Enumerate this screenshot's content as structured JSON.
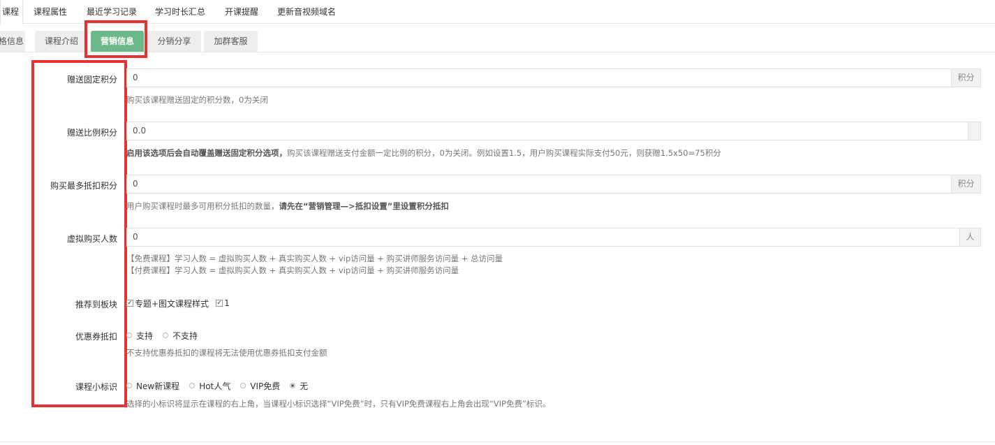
{
  "top_tabs": [
    "课程",
    "课程属性",
    "最近学习记录",
    "学习时长汇总",
    "开课提醒",
    "更新音视频域名"
  ],
  "sub_tabs": [
    "格信息",
    "课程介绍",
    "营销信息",
    "分销分享",
    "加群客服"
  ],
  "active_sub_tab": "营销信息",
  "form": {
    "fixed_points": {
      "label": "赠送固定积分",
      "value": "0",
      "addon": "积分",
      "help": "购买该课程赠送固定的积分数，0为关闭"
    },
    "ratio_points": {
      "label": "赠送比例积分",
      "value": "0.0",
      "help_bold": "启用该选项后会自动覆盖赠送固定积分选项，",
      "help": "购买该课程赠送支付金额一定比例的积分，0为关闭。例如设置1.5，用户购买课程实际支付50元，则获赠1.5x50=75积分"
    },
    "max_deduct": {
      "label": "购买最多抵扣积分",
      "value": "0",
      "addon": "积分",
      "help": "用户购买课程时最多可用积分抵扣的数量，",
      "help_bold": "请先在“营销管理—>抵扣设置”里设置积分抵扣"
    },
    "virtual_buyers": {
      "label": "虚拟购买人数",
      "value": "0",
      "addon": "人",
      "help_line1": "【免费课程】学习人数 = 虚拟购买人数 + 真实购买人数 + vip访问量 + 购买讲师服务访问量 + 总访问量",
      "help_line2": "【付费课程】学习人数 = 虚拟购买人数 + 真实购买人数 + vip访问量 + 购买讲师服务访问量"
    },
    "recommend": {
      "label": "推荐到板块",
      "option1": "专题+图文课程样式",
      "option2": "1"
    },
    "coupon": {
      "label": "优惠券抵扣",
      "options": [
        "支持",
        "不支持"
      ],
      "selected": "",
      "help": "不支持优惠券抵扣的课程将无法使用优惠券抵扣支付金额"
    },
    "badge": {
      "label": "课程小标识",
      "options": [
        "New新课程",
        "Hot人气",
        "VIP免费",
        "无"
      ],
      "selected": "无",
      "help": "选择的小标识将显示在课程的右上角，当课程小标识选择“VIP免费”时，只有VIP免费课程右上角会出现“VIP免费”标识。"
    }
  },
  "colors": {
    "active_tab": "#6db88a",
    "highlight": "#e63232"
  }
}
